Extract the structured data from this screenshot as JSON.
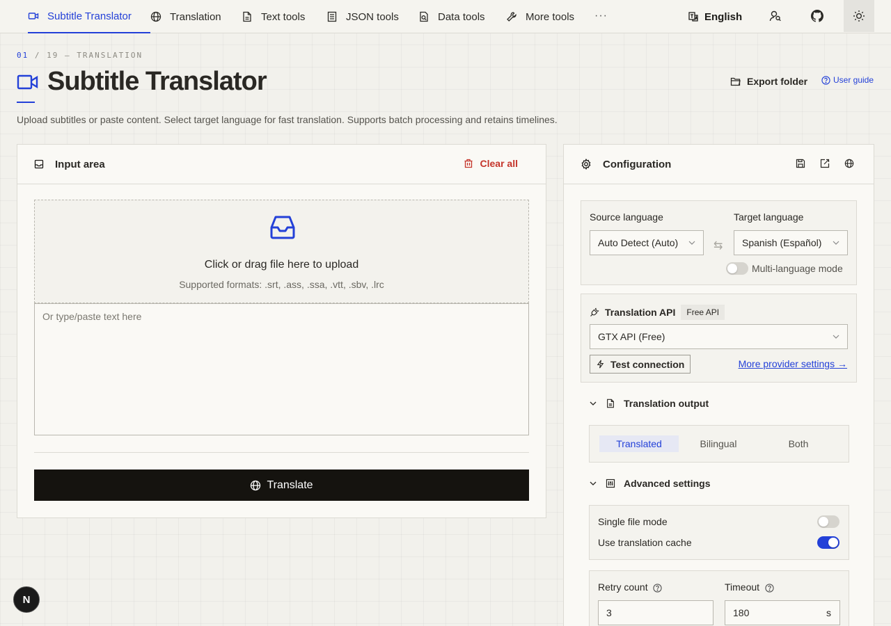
{
  "nav": {
    "items": [
      {
        "label": "Subtitle Translator",
        "icon": "video-icon",
        "active": true
      },
      {
        "label": "Translation",
        "icon": "globe-icon"
      },
      {
        "label": "Text tools",
        "icon": "document-icon"
      },
      {
        "label": "JSON tools",
        "icon": "list-document-icon"
      },
      {
        "label": "Data tools",
        "icon": "search-document-icon"
      },
      {
        "label": "More tools",
        "icon": "wrench-icon"
      }
    ],
    "more": "···",
    "language": "English"
  },
  "header": {
    "crumb_num": "01",
    "crumb_rest": " / 19 — TRANSLATION",
    "title": "Subtitle Translator",
    "export_label": "Export folder",
    "guide_label": "User guide",
    "description": "Upload subtitles or paste content. Select target language for fast translation. Supports batch processing and retains timelines."
  },
  "input_panel": {
    "title": "Input area",
    "clear_label": "Clear all",
    "upload_main": "Click or drag file here to upload",
    "upload_formats": "Supported formats: .srt, .ass, .ssa, .vtt, .sbv, .lrc",
    "paste_placeholder": "Or type/paste text here",
    "translate_label": "Translate"
  },
  "config": {
    "title": "Configuration",
    "source_label": "Source language",
    "source_value": "Auto Detect (Auto)",
    "target_label": "Target language",
    "target_value": "Spanish (Español)",
    "multi_lang_label": "Multi-language mode",
    "multi_lang_on": false,
    "api_title": "Translation API",
    "api_badge": "Free API",
    "api_value": "GTX API (Free)",
    "test_label": "Test connection",
    "more_settings_label": "More provider settings →",
    "output_title": "Translation output",
    "output_options": [
      "Translated",
      "Bilingual",
      "Both"
    ],
    "output_selected": "Translated",
    "advanced_title": "Advanced settings",
    "single_file_label": "Single file mode",
    "single_file_on": false,
    "cache_label": "Use translation cache",
    "cache_on": true,
    "retry_label": "Retry count",
    "retry_value": "3",
    "timeout_label": "Timeout",
    "timeout_value": "180",
    "timeout_unit": "s"
  },
  "next_badge": "N",
  "colors": {
    "accent": "#2340d8",
    "danger": "#c4342a",
    "primary_button": "#15130f"
  }
}
